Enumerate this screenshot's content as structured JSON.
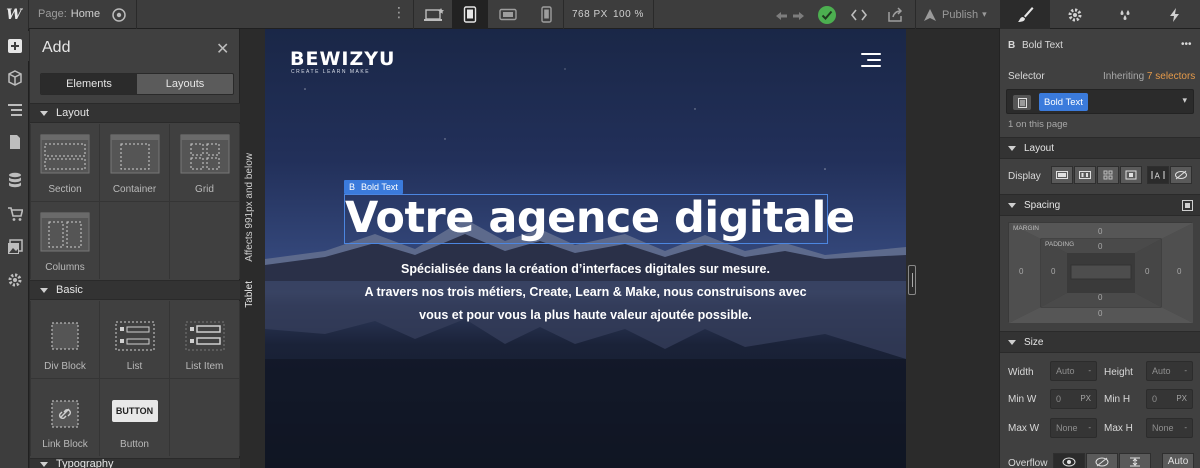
{
  "topbar": {
    "logo": "W",
    "page_prefix": "Page:",
    "page_name": "Home",
    "viewport_width": "768 PX",
    "zoom": "100 %",
    "publish_label": "Publish",
    "devices": [
      "desktop-star-icon",
      "tablet-icon",
      "mobile-landscape-icon",
      "mobile-portrait-icon"
    ],
    "active_device": "tablet",
    "tabs": [
      "style-brush-icon",
      "settings-gear-icon",
      "interactions-drops-icon",
      "lightning-icon"
    ],
    "colors": {
      "accent_green": "#4caf50",
      "selection_blue": "#3b7bdc"
    }
  },
  "rail": [
    "add-icon",
    "symbols-cube-icon",
    "navigator-icon",
    "pages-icon",
    "cms-database-icon",
    "ecommerce-cart-icon",
    "assets-image-icon",
    "settings-gear-icon"
  ],
  "addpanel": {
    "title": "Add",
    "close": "✕",
    "tabs": {
      "elements": "Elements",
      "layouts": "Layouts"
    },
    "sections": {
      "layout": "Layout",
      "basic": "Basic",
      "typography": "Typography"
    },
    "layout_items": [
      "Section",
      "Container",
      "Grid",
      "Columns"
    ],
    "basic_items": [
      "Div Block",
      "List",
      "List Item",
      "Link Block",
      "Button"
    ],
    "button_preview": "BUTTON"
  },
  "tablet_tab": {
    "label": "Tablet",
    "note": "Affects 991px and below"
  },
  "hero": {
    "brand": "BEWIZYU",
    "tagline": "CREATE LEARN MAKE",
    "selected_badge": "Bold Text",
    "selected_badge_icon": "B",
    "heading": "Votre agence digitale",
    "sub_line1": "Spécialisée dans la création d’interfaces digitales sur mesure.",
    "sub_line2": "A travers nos trois métiers, Create, Learn & Make, nous construisons avec",
    "sub_line3": "vous et pour vous la plus haute valeur ajoutée possible."
  },
  "style": {
    "element_icon": "B",
    "element_name": "Bold Text",
    "more": "•••",
    "selector_label": "Selector",
    "inheriting_prefix": "Inheriting",
    "inheriting_count": "7 selectors",
    "selector_chip": "Bold Text",
    "on_page": "1 on this page",
    "layout_head": "Layout",
    "display_label": "Display",
    "spacing_head": "Spacing",
    "margin_label": "MARGIN",
    "padding_label": "PADDING",
    "margin": {
      "top": "0",
      "right": "0",
      "bottom": "0",
      "left": "0"
    },
    "padding": {
      "top": "0",
      "right": "0",
      "bottom": "0",
      "left": "0"
    },
    "size_head": "Size",
    "width_label": "Width",
    "width_val": "Auto",
    "height_label": "Height",
    "height_val": "Auto",
    "minw_label": "Min W",
    "minw_val": "0",
    "minw_unit": "PX",
    "minh_label": "Min H",
    "minh_val": "0",
    "minh_unit": "PX",
    "maxw_label": "Max W",
    "maxw_val": "None",
    "maxh_label": "Max H",
    "maxh_val": "None",
    "dash": "-",
    "overflow_label": "Overflow",
    "overflow_auto": "Auto"
  }
}
